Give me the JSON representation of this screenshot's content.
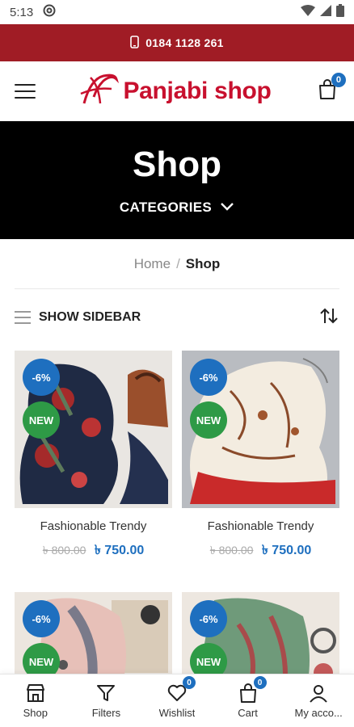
{
  "status_bar": {
    "time": "5:13"
  },
  "topbar": {
    "phone": "0184 1128 261"
  },
  "header": {
    "logo_text": "Panjabi shop",
    "cart_count": "0"
  },
  "hero": {
    "title": "Shop",
    "categories_label": "CATEGORIES"
  },
  "breadcrumb": {
    "home": "Home",
    "separator": "/",
    "current": "Shop"
  },
  "toolbar": {
    "sidebar_label": "SHOW SIDEBAR"
  },
  "products": [
    {
      "title": "Fashionable Trendy",
      "old_price": "৳ 800.00",
      "new_price": "৳ 750.00",
      "sale_badge": "-6%",
      "new_badge": "NEW"
    },
    {
      "title": "Fashionable Trendy",
      "old_price": "৳ 800.00",
      "new_price": "৳ 750.00",
      "sale_badge": "-6%",
      "new_badge": "NEW"
    },
    {
      "sale_badge": "-6%",
      "new_badge": "NEW"
    },
    {
      "sale_badge": "-6%",
      "new_badge": "NEW"
    }
  ],
  "bottom_nav": {
    "shop": "Shop",
    "filters": "Filters",
    "wishlist": "Wishlist",
    "wishlist_count": "0",
    "cart": "Cart",
    "cart_count": "0",
    "account": "My acco..."
  },
  "colors": {
    "brand_red": "#a01c25",
    "logo_red": "#c8102e",
    "accent_blue": "#1e6fbf",
    "new_green": "#2e9a46"
  }
}
